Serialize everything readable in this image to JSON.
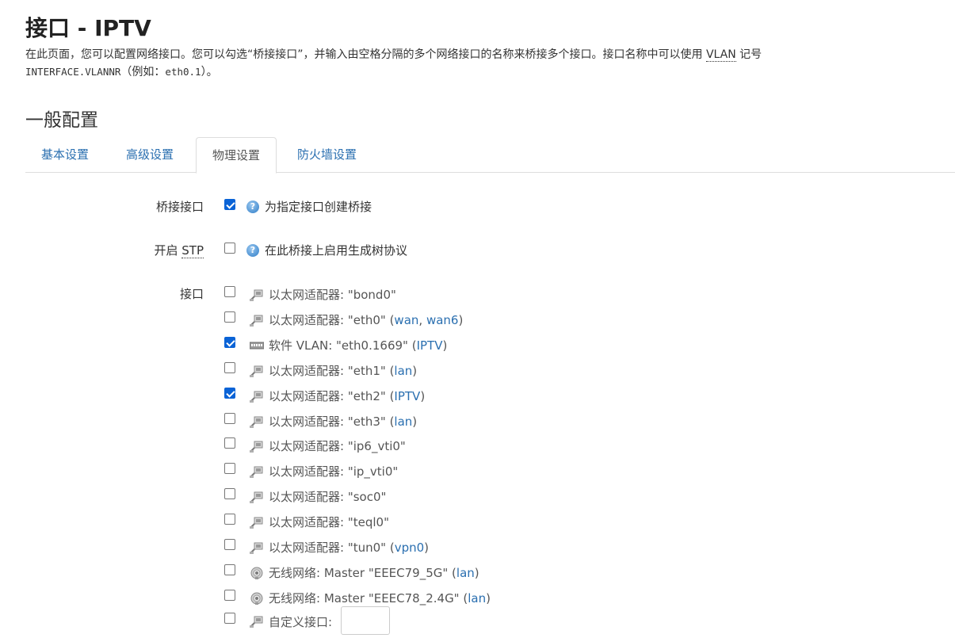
{
  "page": {
    "title": "接口 - IPTV",
    "description_line1": "在此页面，您可以配置网络接口。您可以勾选“桥接接口”，并输入由空格分隔的多个网络接口的名称来桥接多个接口。接口名称中可以使用 ",
    "description_vlan": "VLAN",
    "description_line1_end": " 记号",
    "description_mono": "INTERFACE.VLANNR",
    "description_line2": "（例如：",
    "description_example": "eth0.1",
    "description_line2_end": "）。"
  },
  "section_title": "一般配置",
  "tabs": [
    {
      "label": "基本设置",
      "active": false
    },
    {
      "label": "高级设置",
      "active": false
    },
    {
      "label": "物理设置",
      "active": true
    },
    {
      "label": "防火墙设置",
      "active": false
    }
  ],
  "bridge": {
    "label": "桥接接口",
    "checked": true,
    "help": "为指定接口创建桥接"
  },
  "stp": {
    "label_prefix": "开启 ",
    "label_abbr": "STP",
    "checked": false,
    "help": "在此桥接上启用生成树协议"
  },
  "interfaces": {
    "label": "接口",
    "items": [
      {
        "type": "以太网适配器",
        "name": "\"bond0\"",
        "icon": "ethernet-icon",
        "checked": false,
        "nets": []
      },
      {
        "type": "以太网适配器",
        "name": "\"eth0\"",
        "icon": "ethernet-icon",
        "checked": false,
        "nets": [
          "wan",
          "wan6"
        ]
      },
      {
        "type": "软件 VLAN",
        "name": "\"eth0.1669\"",
        "icon": "vlan-icon",
        "checked": true,
        "nets": [
          "IPTV"
        ]
      },
      {
        "type": "以太网适配器",
        "name": "\"eth1\"",
        "icon": "ethernet-icon",
        "checked": false,
        "nets": [
          "lan"
        ]
      },
      {
        "type": "以太网适配器",
        "name": "\"eth2\"",
        "icon": "ethernet-icon",
        "checked": true,
        "nets": [
          "IPTV"
        ]
      },
      {
        "type": "以太网适配器",
        "name": "\"eth3\"",
        "icon": "ethernet-icon",
        "checked": false,
        "nets": [
          "lan"
        ]
      },
      {
        "type": "以太网适配器",
        "name": "\"ip6_vti0\"",
        "icon": "ethernet-icon",
        "checked": false,
        "nets": []
      },
      {
        "type": "以太网适配器",
        "name": "\"ip_vti0\"",
        "icon": "ethernet-icon",
        "checked": false,
        "nets": []
      },
      {
        "type": "以太网适配器",
        "name": "\"soc0\"",
        "icon": "ethernet-icon",
        "checked": false,
        "nets": []
      },
      {
        "type": "以太网适配器",
        "name": "\"teql0\"",
        "icon": "ethernet-icon",
        "checked": false,
        "nets": []
      },
      {
        "type": "以太网适配器",
        "name": "\"tun0\"",
        "icon": "ethernet-icon",
        "checked": false,
        "nets": [
          "vpn0"
        ]
      },
      {
        "type": "无线网络",
        "name": "Master \"EEEC79_5G\"",
        "icon": "wifi-icon",
        "checked": false,
        "nets": [
          "lan"
        ]
      },
      {
        "type": "无线网络",
        "name": "Master \"EEEC78_2.4G\"",
        "icon": "wifi-icon",
        "checked": false,
        "nets": [
          "lan"
        ]
      }
    ],
    "custom_label": "自定义接口:",
    "custom_value": ""
  }
}
